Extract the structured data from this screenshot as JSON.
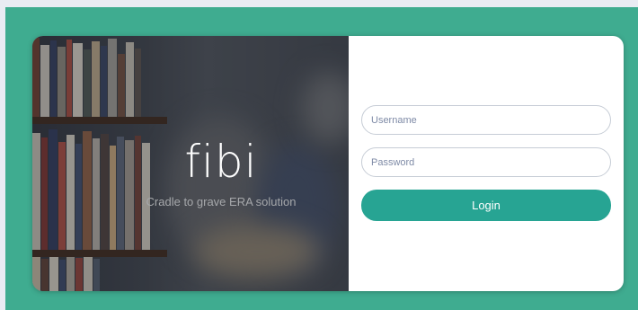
{
  "brand": {
    "logo_text": "fibi",
    "tagline": "Cradle to grave ERA solution"
  },
  "login_form": {
    "username_placeholder": "Username",
    "username_value": "",
    "password_placeholder": "Password",
    "password_value": "",
    "login_label": "Login"
  },
  "colors": {
    "page_background": "#3fac90",
    "button": "#27a493",
    "tagline": "#a6a8ab"
  }
}
